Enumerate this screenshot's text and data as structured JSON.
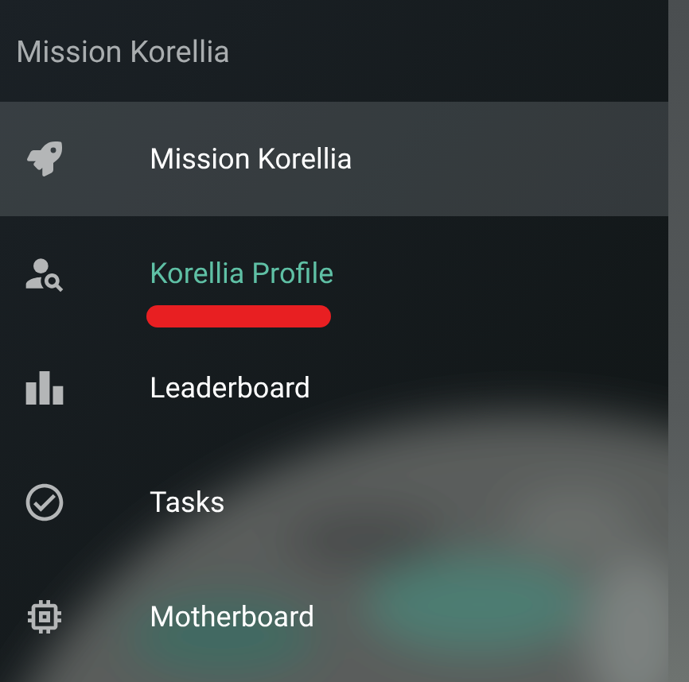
{
  "header": {
    "title": "Mission Korellia"
  },
  "menu": [
    {
      "label": "Mission Korellia",
      "highlighted": true,
      "selected": false,
      "annotated": false
    },
    {
      "label": "Korellia Profile",
      "highlighted": false,
      "selected": true,
      "annotated": true
    },
    {
      "label": "Leaderboard",
      "highlighted": false,
      "selected": false,
      "annotated": false
    },
    {
      "label": "Tasks",
      "highlighted": false,
      "selected": false,
      "annotated": false
    },
    {
      "label": "Motherboard",
      "highlighted": false,
      "selected": false,
      "annotated": false
    }
  ]
}
